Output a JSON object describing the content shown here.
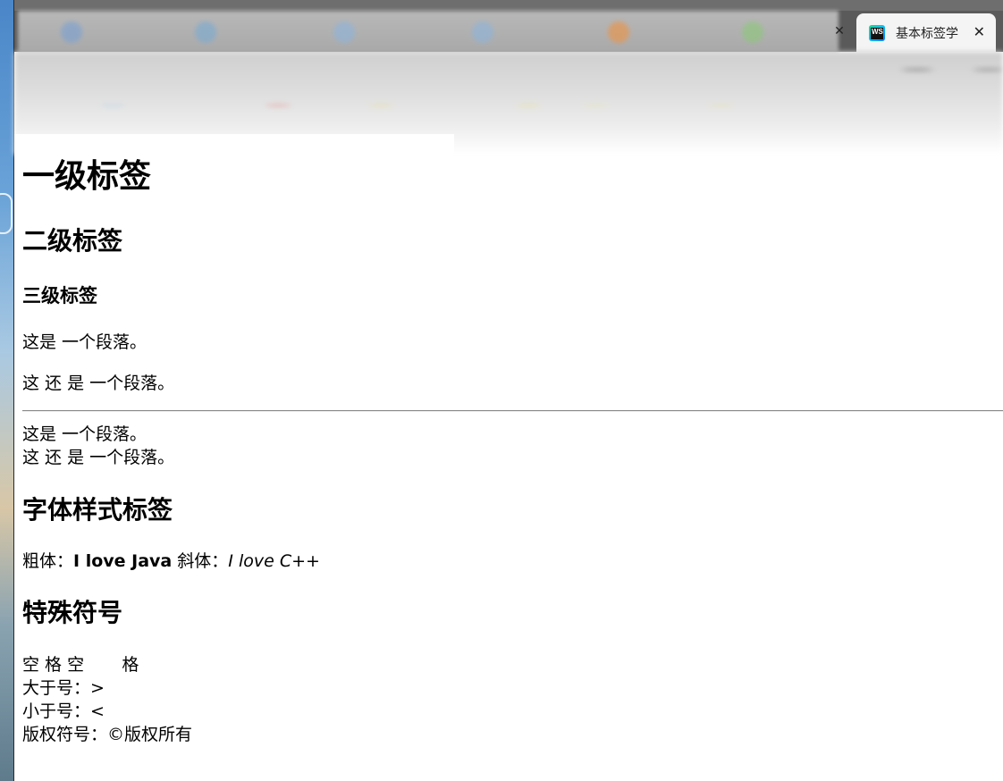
{
  "browser": {
    "active_tab": {
      "title": "基本标签学",
      "favicon_text": "WS",
      "close_glyph": "✕"
    },
    "prev_tab_close_glyph": "✕"
  },
  "content": {
    "h1": "一级标签",
    "h2": "二级标签",
    "h3": "三级标签",
    "para1": "这是 一个段落。",
    "para2": "这 还 是 一个段落。",
    "line1": "这是 一个段落。",
    "line2": "这 还 是 一个段落。",
    "font_heading": "字体样式标签",
    "bold_label": "粗体：",
    "bold_text": "I love Java",
    "italic_label": " 斜体：",
    "italic_text": "I love C++",
    "special_heading": "特殊符号",
    "space_line": "空 格 空       格",
    "gt_line": "大于号：>",
    "lt_line": "小于号：<",
    "copy_line": "版权符号：©版权所有"
  }
}
